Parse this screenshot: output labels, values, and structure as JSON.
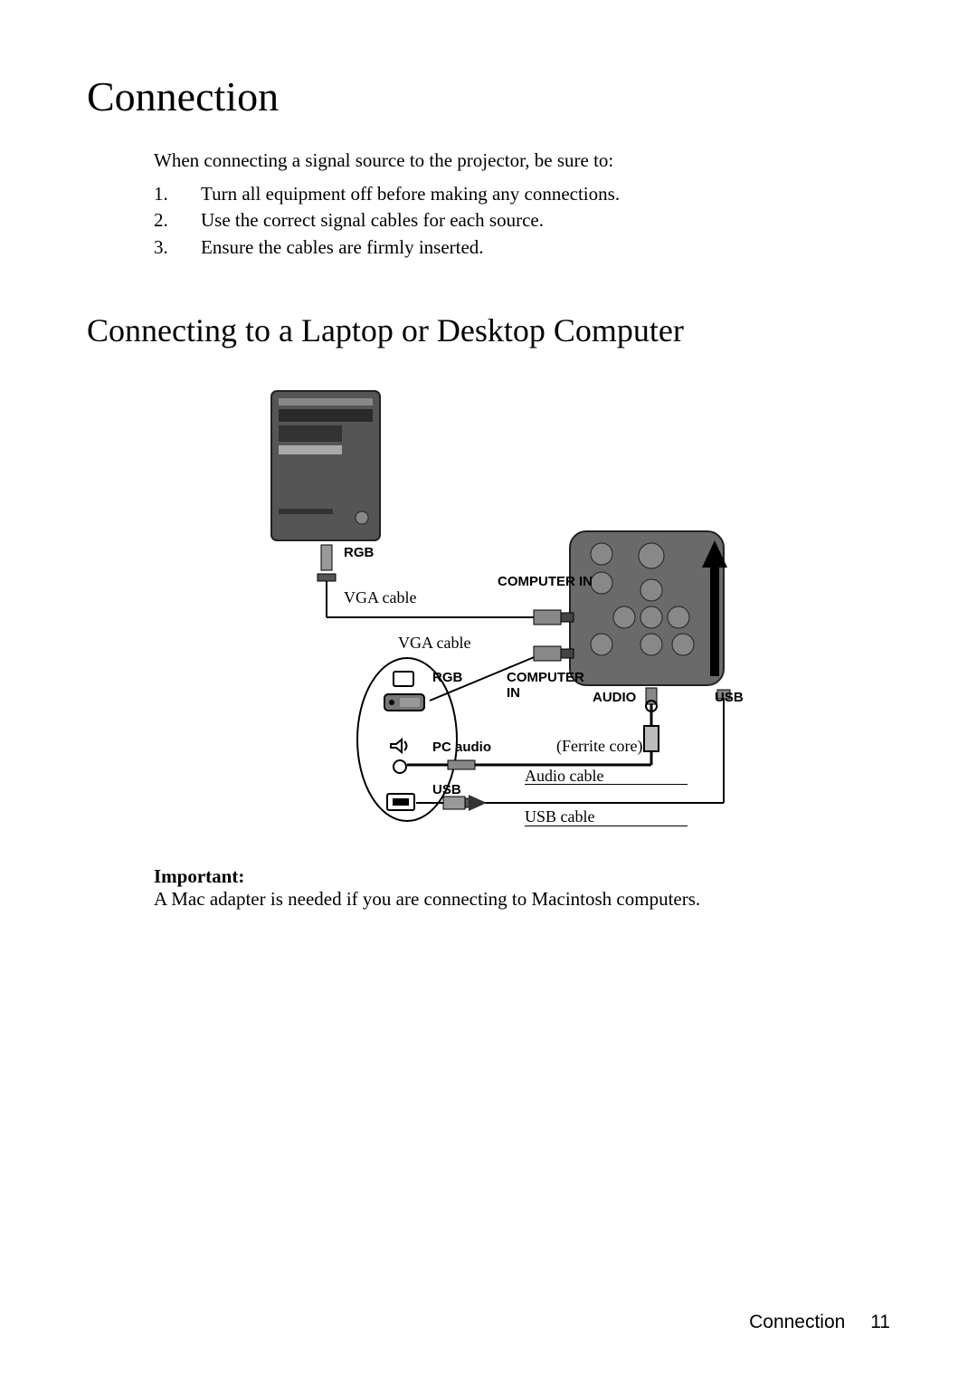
{
  "title": "Connection",
  "intro": "When connecting a signal source to the projector, be sure to:",
  "list": [
    "Turn all equipment off before making any connections.",
    "Use the correct signal cables for each source.",
    "Ensure the cables are firmly inserted."
  ],
  "subtitle": "Connecting to a Laptop or Desktop Computer",
  "diagram": {
    "rgb1": "RGB",
    "computer_in_top": "COMPUTER IN",
    "vga_cable_1": "VGA cable",
    "vga_cable_2": "VGA cable",
    "rgb2": "RGB",
    "computer_in_2": "COMPUTER\nIN",
    "audio": "AUDIO",
    "usb_right": "USB",
    "pc_audio": "PC audio",
    "ferrite": "(Ferrite core)",
    "audio_cable": "Audio cable",
    "usb_left": "USB",
    "usb_cable": "USB cable"
  },
  "important_label": "Important:",
  "important_text": "A Mac adapter is needed if you are connecting to Macintosh computers.",
  "footer_section": "Connection",
  "footer_page": "11"
}
